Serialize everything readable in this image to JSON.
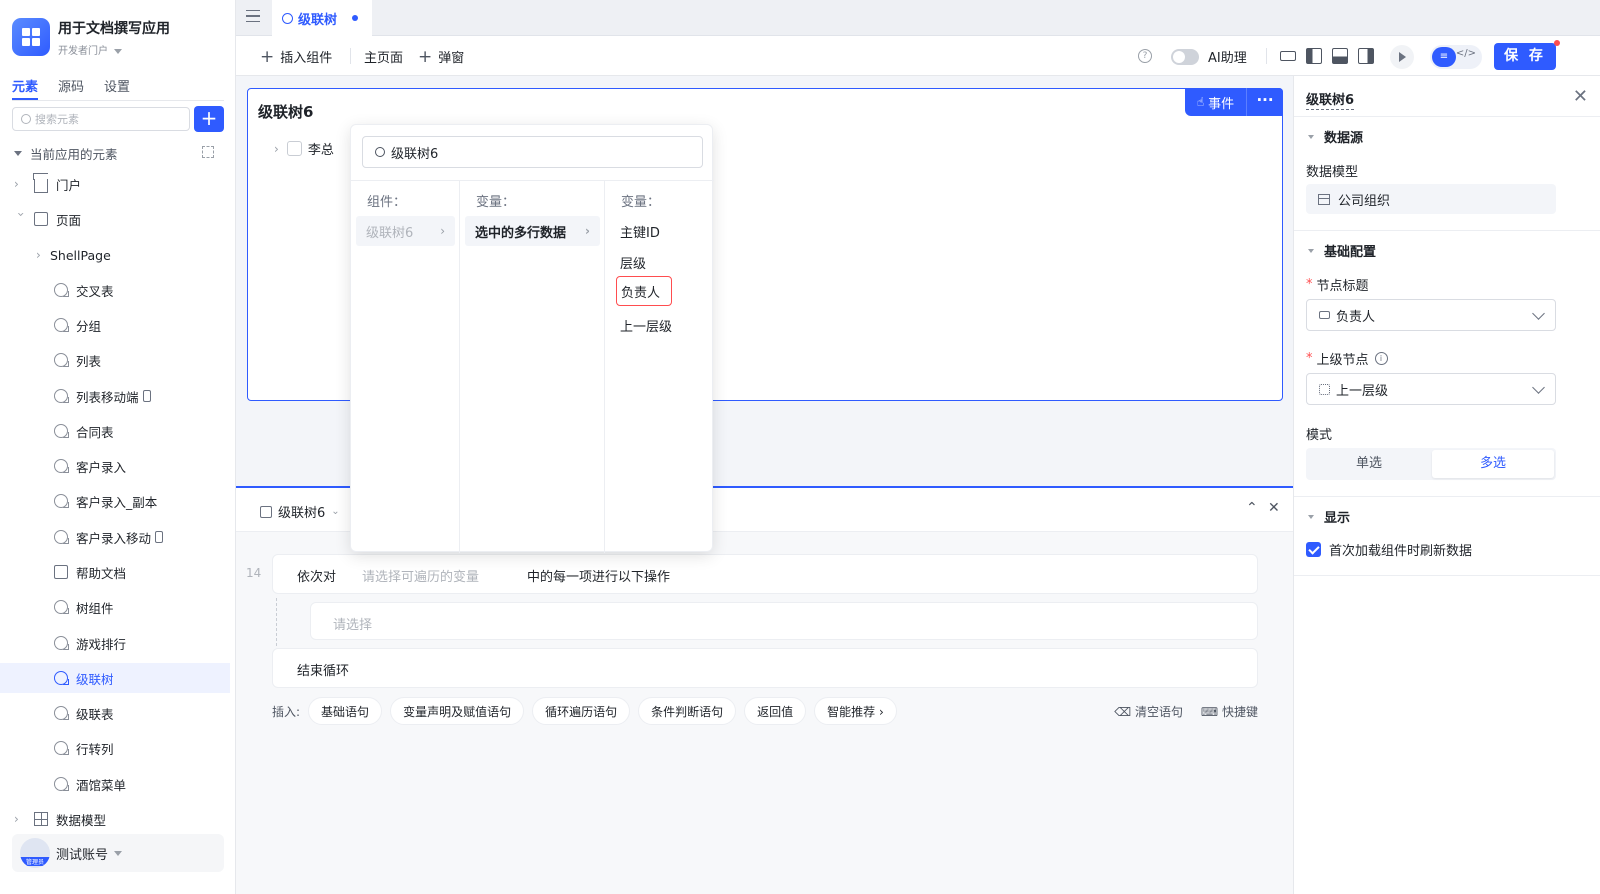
{
  "app": {
    "title": "用于文档撰写应用",
    "subtitle": "开发者门户"
  },
  "sidebar": {
    "tabs": [
      "元素",
      "源码",
      "设置"
    ],
    "search_placeholder": "搜索元素",
    "section_label": "当前应用的元素",
    "portal": "门户",
    "pages_label": "页面",
    "shell_page": "ShellPage",
    "pages": [
      "交叉表",
      "分组",
      "列表",
      "列表移动端",
      "合同表",
      "客户录入",
      "客户录入_副本",
      "客户录入移动",
      "帮助文档",
      "树组件",
      "游戏排行",
      "级联树",
      "级联表",
      "行转列",
      "酒馆菜单"
    ],
    "data_model": "数据模型",
    "user": {
      "name": "测试账号",
      "role": "管理员"
    }
  },
  "tabbar": {
    "active_tab": "级联树"
  },
  "toolbar": {
    "insert_component": "插入组件",
    "home_page": "主页面",
    "popup": "弹窗",
    "ai_assistant": "AI助理",
    "save": "保 存"
  },
  "canvas": {
    "component_title": "级联树6",
    "event_btn": "事件",
    "more_btn": "···",
    "tree_node": "李总"
  },
  "picker": {
    "search_value": "级联树6",
    "col1_title": "组件：",
    "col1_item": "级联树6",
    "col2_title": "变量：",
    "col2_item": "选中的多行数据",
    "col3_title": "变量：",
    "col3_items": [
      "主键ID",
      "层级",
      "负责人",
      "上一层级"
    ]
  },
  "logic": {
    "component": "级联树6",
    "line_no": "14",
    "loop_prefix": "依次对",
    "loop_placeholder": "请选择可遍历的变量",
    "loop_suffix": "中的每一项进行以下操作",
    "inner_placeholder": "请选择",
    "loop_end": "结束循环",
    "insert_label": "插入:",
    "insert_chips": [
      "基础语句",
      "变量声明及赋值语句",
      "循环遍历语句",
      "条件判断语句",
      "返回值",
      "智能推荐 ›"
    ],
    "clear": "清空语句",
    "shortcuts": "快捷键"
  },
  "props": {
    "header": "级联树6",
    "datasource_title": "数据源",
    "data_model_label": "数据模型",
    "data_model_value": "公司组织",
    "basic_title": "基础配置",
    "node_title_label": "节点标题",
    "node_title_value": "负责人",
    "parent_node_label": "上级节点",
    "parent_node_value": "上一层级",
    "mode_label": "模式",
    "mode_options": [
      "单选",
      "多选"
    ],
    "display_title": "显示",
    "refresh_label": "首次加载组件时刷新数据"
  }
}
